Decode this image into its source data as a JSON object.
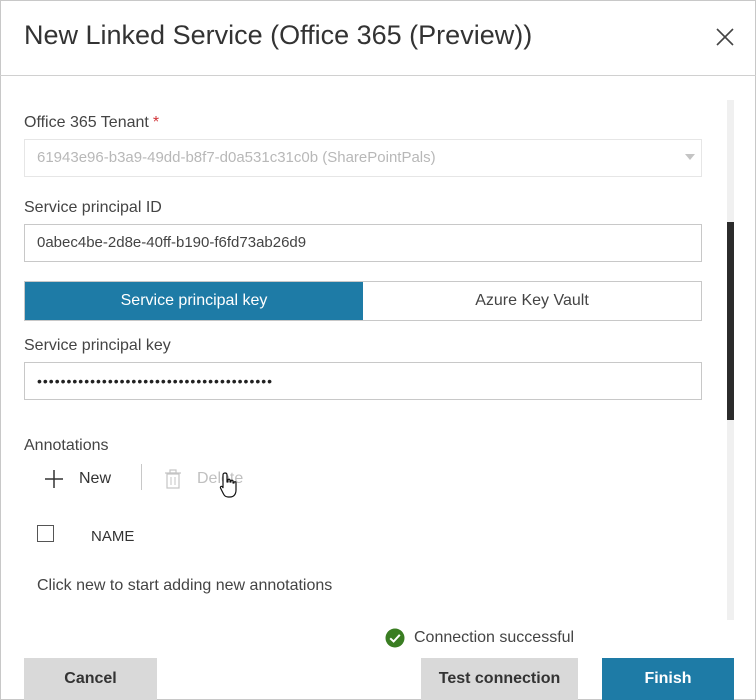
{
  "dialog": {
    "title": "New Linked Service (Office 365 (Preview))"
  },
  "form": {
    "tenant": {
      "label": "Office 365 Tenant",
      "required_mark": "*",
      "value": "61943e96-b3a9-49dd-b8f7-d0a531c31c0b (SharePointPals)"
    },
    "principal_id": {
      "label": "Service principal ID",
      "value": "0abec4be-2d8e-40ff-b190-f6fd73ab26d9"
    },
    "auth_toggle": {
      "options": [
        "Service principal key",
        "Azure Key Vault"
      ],
      "selected": "Service principal key"
    },
    "principal_key": {
      "label": "Service principal key",
      "masked_value": "••••••••••••••••••••••••••••••••••••••••"
    }
  },
  "annotations": {
    "heading": "Annotations",
    "new_label": "New",
    "delete_label": "Delete",
    "column_header": "NAME",
    "empty_message": "Click new to start adding new annotations"
  },
  "status": {
    "text": "Connection successful"
  },
  "footer": {
    "cancel_label": "Cancel",
    "test_label": "Test connection",
    "finish_label": "Finish"
  },
  "colors": {
    "accent": "#1e7ba6",
    "success": "#3a7d22",
    "required": "#d13438"
  }
}
